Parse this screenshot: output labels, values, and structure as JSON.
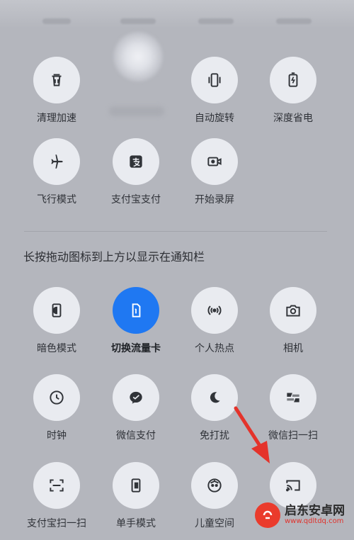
{
  "row1": [
    {
      "label": "清理加速",
      "icon": "trash-icon"
    },
    {
      "label": "",
      "icon": "blurred-icon"
    },
    {
      "label": "自动旋转",
      "icon": "rotate-icon"
    },
    {
      "label": "深度省电",
      "icon": "battery-saver-icon"
    }
  ],
  "row2": [
    {
      "label": "飞行模式",
      "icon": "airplane-icon"
    },
    {
      "label": "支付宝支付",
      "icon": "alipay-icon"
    },
    {
      "label": "开始录屏",
      "icon": "screen-record-icon"
    }
  ],
  "hint": "长按拖动图标到上方以显示在通知栏",
  "row3": [
    {
      "label": "暗色模式",
      "icon": "dark-mode-icon"
    },
    {
      "label": "切换流量卡",
      "icon": "sim-card-icon",
      "active": true
    },
    {
      "label": "个人热点",
      "icon": "hotspot-icon"
    },
    {
      "label": "相机",
      "icon": "camera-icon"
    }
  ],
  "row4": [
    {
      "label": "时钟",
      "icon": "clock-icon"
    },
    {
      "label": "微信支付",
      "icon": "wechat-pay-icon"
    },
    {
      "label": "免打扰",
      "icon": "moon-icon"
    },
    {
      "label": "微信扫一扫",
      "icon": "wechat-scan-icon"
    }
  ],
  "row5": [
    {
      "label": "支付宝扫一扫",
      "icon": "alipay-scan-icon"
    },
    {
      "label": "单手模式",
      "icon": "one-hand-icon"
    },
    {
      "label": "儿童空间",
      "icon": "kids-space-icon"
    },
    {
      "label": "",
      "icon": "cast-icon"
    }
  ],
  "watermark": {
    "title": "启东安卓网",
    "url": "www.qdltdq.com"
  },
  "colors": {
    "background": "#b4b6bd",
    "tile": "#e9ebf0",
    "active": "#1f78f2",
    "arrow": "#e4332b"
  }
}
